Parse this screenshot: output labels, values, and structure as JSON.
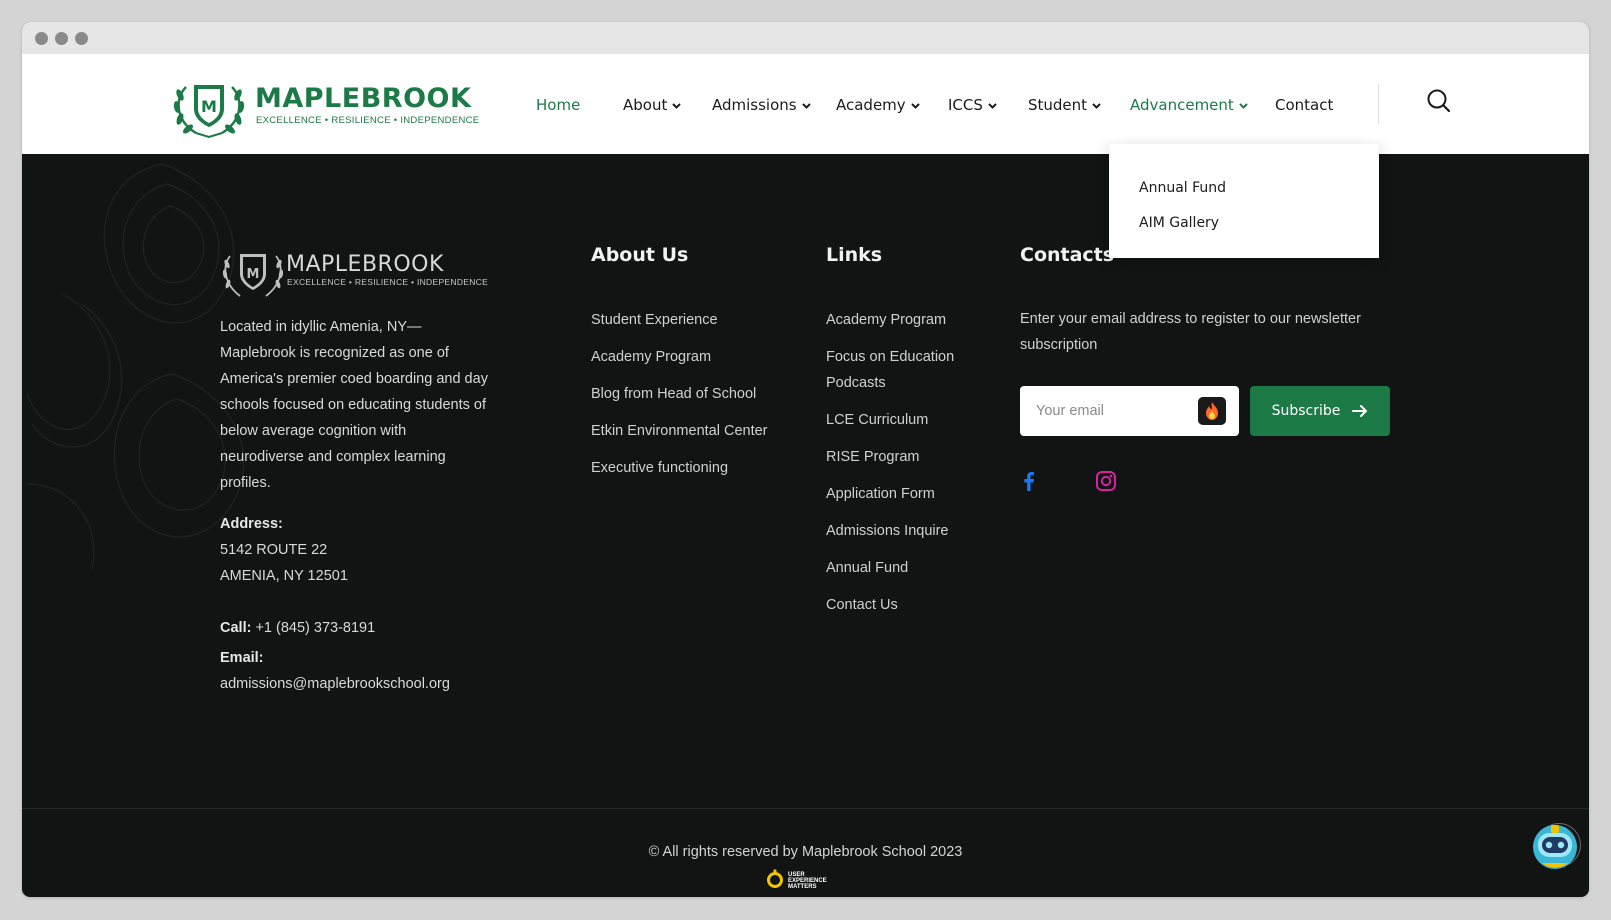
{
  "header": {
    "logo_name": "MAPLEBROOK",
    "logo_tagline": "EXCELLENCE • RESILIENCE • INDEPENDENCE",
    "nav": [
      {
        "label": "Home",
        "active": true,
        "dropdown": false
      },
      {
        "label": "About",
        "active": false,
        "dropdown": true
      },
      {
        "label": "Admissions",
        "active": false,
        "dropdown": true
      },
      {
        "label": "Academy",
        "active": false,
        "dropdown": true
      },
      {
        "label": "ICCS",
        "active": false,
        "dropdown": true
      },
      {
        "label": "Student",
        "active": false,
        "dropdown": true
      },
      {
        "label": "Advancement",
        "active": true,
        "dropdown": true
      },
      {
        "label": "Contact",
        "active": false,
        "dropdown": false
      }
    ],
    "search_icon": "search-icon"
  },
  "dropdown": {
    "items": [
      "Annual Fund",
      "AIM Gallery"
    ]
  },
  "footer": {
    "logo_name": "MAPLEBROOK",
    "logo_tagline": "EXCELLENCE • RESILIENCE • INDEPENDENCE",
    "about_text": "Located in idyllic Amenia, NY—Maplebrook is recognized as one of America's premier coed boarding and day schools focused on educating students of below average cognition with neurodiverse and complex learning profiles.",
    "address_label": "Address:",
    "address_line1": "5142 ROUTE 22",
    "address_line2": "AMENIA, NY 12501",
    "call_label": "Call:",
    "call_value": "+1 (845) 373-8191",
    "email_label": "Email:",
    "email_value": "admissions@maplebrookschool.org",
    "about_title": "About Us",
    "about_links": [
      "Student Experience",
      "Academy Program",
      "Blog from Head of School",
      "Etkin Environmental Center",
      "Executive functioning"
    ],
    "links_title": "Links",
    "links": [
      "Academy Program",
      "Focus on Education Podcasts",
      "LCE Curriculum",
      "RISE Program",
      "Application Form",
      "Admissions Inquire",
      "Annual Fund",
      "Contact Us"
    ],
    "contacts_title": "Contacts",
    "newsletter_text": "Enter your email address to register to our newsletter subscription",
    "email_placeholder": "Your email",
    "subscribe_label": "Subscribe",
    "copyright": "© All rights reserved by Maplebrook School 2023",
    "badge_text": "USER EXPERIENCE MATTERS"
  },
  "colors": {
    "brand_green": "#1c7a47",
    "footer_bg": "#111413",
    "facebook": "#1877f2",
    "instagram": "#d6249f"
  }
}
